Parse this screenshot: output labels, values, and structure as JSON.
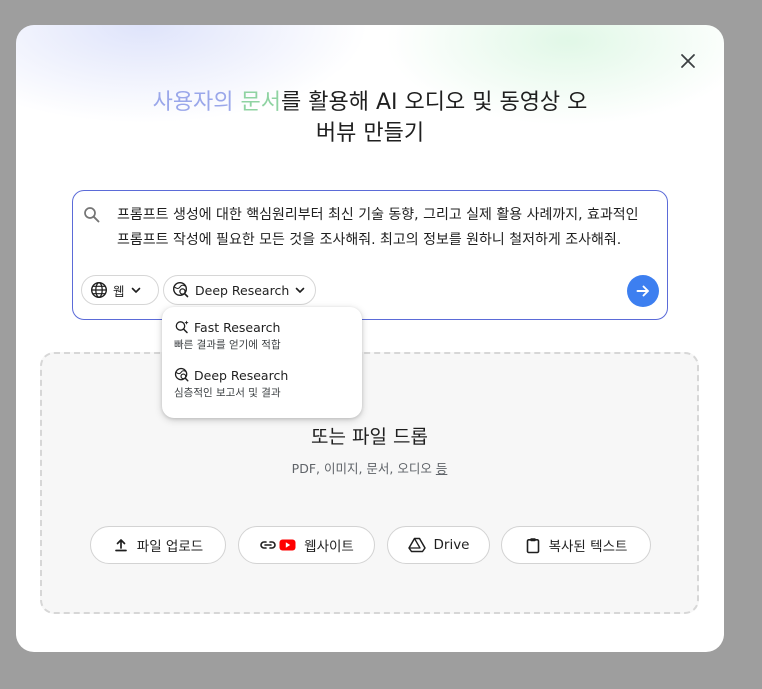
{
  "title": {
    "highlight_a": "사용자의",
    "highlight_b": "문서",
    "rest_line1": "를 활용해 AI 오디오 및 동영상 오",
    "line2": "버뷰 만들기"
  },
  "query": {
    "text": "프롬프트 생성에 대한 핵심원리부터 최신 기술 동향, 그리고 실제 활용 사례까지, 효과적인 프롬프트 작성에 필요한 모든 것을 조사해줘. 최고의 정보를 원하니 철저하게 조사해줘.",
    "source_chip_label": "웹",
    "mode_chip_label": "Deep Research"
  },
  "dropdown": {
    "items": [
      {
        "label": "Fast Research",
        "description": "빠른 결과를 얻기에 적합",
        "icon": "fast-research-icon"
      },
      {
        "label": "Deep Research",
        "description": "심층적인 보고서 및 결과",
        "icon": "deep-research-icon"
      }
    ]
  },
  "drop_zone": {
    "title": "또는 파일 드롭",
    "subtitle_prefix": "PDF, 이미지, 문서, 오디오 ",
    "subtitle_link": "등"
  },
  "sources": {
    "upload_label": "파일 업로드",
    "website_label": "웹사이트",
    "drive_label": "Drive",
    "copied_text_label": "복사된 텍스트"
  },
  "colors": {
    "accent": "#3d7ff0",
    "query_border": "#5b6bd8",
    "title_highlight_a": "#9aa7ea",
    "title_highlight_b": "#8fd3a2",
    "youtube_red": "#ff0000"
  }
}
